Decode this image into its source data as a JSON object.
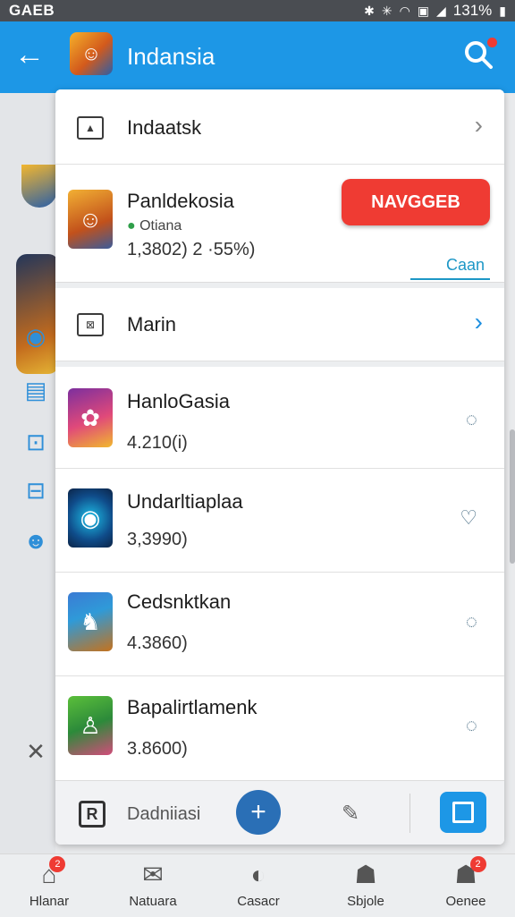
{
  "status_bar": {
    "carrier": "GAEB",
    "battery": "131%"
  },
  "app_bar": {
    "title": "Indansia"
  },
  "rows": {
    "first": {
      "title": "Indaatsk"
    },
    "featured": {
      "title": "Panldekosia",
      "tag": "Otiana",
      "stats": "1,3802)  2 ·55%)",
      "action_label": "NAVGGEB",
      "link_label": "Caan"
    },
    "menu": {
      "title": "Marin"
    },
    "games": [
      {
        "title": "HanloGasia",
        "sub": "4.210(i)"
      },
      {
        "title": "Undarltiaplaa",
        "sub": "3,3990)"
      },
      {
        "title": "Cedsnktkan",
        "sub": "4.3860)"
      },
      {
        "title": "Bapalirtlamenk",
        "sub": "3.8600)"
      }
    ]
  },
  "card_bottom": {
    "label": "Dadniiasi"
  },
  "bottom_nav": [
    {
      "label": "Hlanar",
      "badge": "2"
    },
    {
      "label": "Natuara",
      "badge": ""
    },
    {
      "label": "Casacr",
      "badge": ""
    },
    {
      "label": "Sbjole",
      "badge": ""
    },
    {
      "label": "Oenee",
      "badge": "2"
    }
  ],
  "colors": {
    "primary": "#1d97e6",
    "accent": "#ef3b33"
  }
}
